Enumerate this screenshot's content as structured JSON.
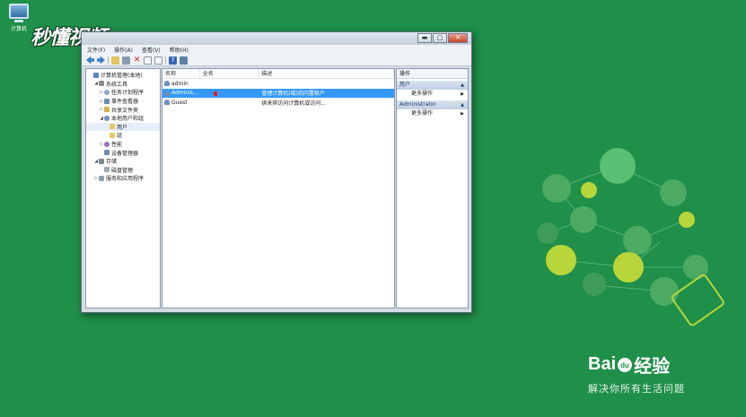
{
  "desktop": {
    "icon_label": "计算机"
  },
  "watermark_top": "秒懂视频",
  "window": {
    "menu": [
      "文件(F)",
      "操作(A)",
      "查看(V)",
      "帮助(H)"
    ],
    "tree": [
      {
        "label": "计算机管理(本地)",
        "indent": 0,
        "exp": "",
        "icon": "comp"
      },
      {
        "label": "系统工具",
        "indent": 1,
        "exp": "◢",
        "icon": "tool"
      },
      {
        "label": "任务计划程序",
        "indent": 2,
        "exp": "▷",
        "icon": "clock"
      },
      {
        "label": "事件查看器",
        "indent": 2,
        "exp": "▷",
        "icon": "evt"
      },
      {
        "label": "共享文件夹",
        "indent": 2,
        "exp": "▷",
        "icon": "share"
      },
      {
        "label": "本地用户和组",
        "indent": 2,
        "exp": "◢",
        "icon": "users"
      },
      {
        "label": "用户",
        "indent": 3,
        "exp": "",
        "icon": "fold"
      },
      {
        "label": "组",
        "indent": 3,
        "exp": "",
        "icon": "fold"
      },
      {
        "label": "性能",
        "indent": 2,
        "exp": "▷",
        "icon": "perf"
      },
      {
        "label": "设备管理器",
        "indent": 2,
        "exp": "",
        "icon": "dev"
      },
      {
        "label": "存储",
        "indent": 1,
        "exp": "◢",
        "icon": "store"
      },
      {
        "label": "磁盘管理",
        "indent": 2,
        "exp": "",
        "icon": "disk"
      },
      {
        "label": "服务和应用程序",
        "indent": 1,
        "exp": "▷",
        "icon": "svc"
      }
    ],
    "columns": {
      "name": "名称",
      "fullname": "全名",
      "desc": "描述"
    },
    "users": [
      {
        "name": "admin",
        "fullname": "",
        "desc": ""
      },
      {
        "name": "Adminis...",
        "fullname": "",
        "desc": "管理计算机(域)的内置帐户"
      },
      {
        "name": "Guest",
        "fullname": "",
        "desc": "供来宾访问计算机或访问..."
      }
    ],
    "actions": {
      "title": "操作",
      "group1": "用户",
      "group1_item": "更多操作",
      "group2": "Administrator",
      "group2_item": "更多操作"
    }
  },
  "baidu": {
    "logo_left": "Bai",
    "logo_paw": "du",
    "logo_right": "经验",
    "slogan": "解决你所有生活问题"
  }
}
